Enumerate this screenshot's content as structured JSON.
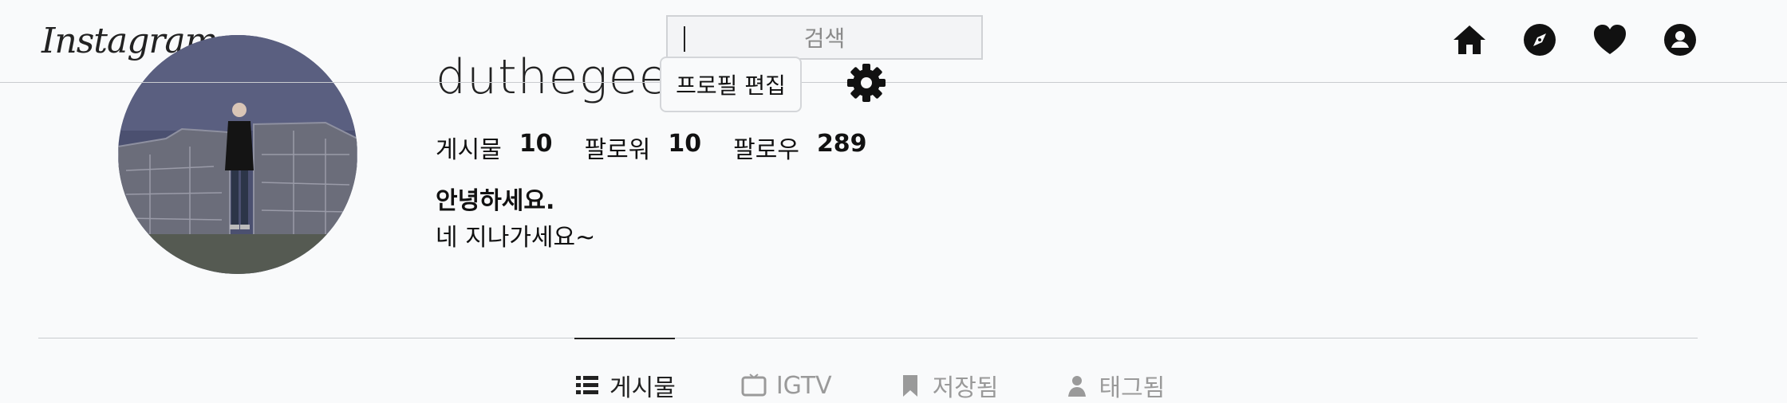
{
  "header": {
    "logo_text": "Instagram",
    "search_placeholder": "검색",
    "nav_icons": [
      "home-icon",
      "explore-compass-icon",
      "activity-heart-icon",
      "profile-icon"
    ]
  },
  "profile": {
    "username": "duthegee",
    "edit_button_label": "프로필 편집",
    "settings_icon": "gear-icon",
    "stats": [
      {
        "label": "게시물",
        "value": "10"
      },
      {
        "label": "팔로워",
        "value": "10"
      },
      {
        "label": "팔로우",
        "value": "289"
      }
    ],
    "bio_name": "안녕하세요.",
    "bio_text": "네 지나가세요~"
  },
  "tabs": [
    {
      "label": "게시물",
      "icon": "grid-icon",
      "active": true
    },
    {
      "label": "IGTV",
      "icon": "igtv-icon",
      "active": false
    },
    {
      "label": "저장됨",
      "icon": "bookmark-icon",
      "active": false
    },
    {
      "label": "태그됨",
      "icon": "tag-person-icon",
      "active": false
    }
  ],
  "colors": {
    "background": "#f9fafb",
    "divider": "#c9cbcf",
    "text": "#111111",
    "muted": "#9a9a9a"
  }
}
